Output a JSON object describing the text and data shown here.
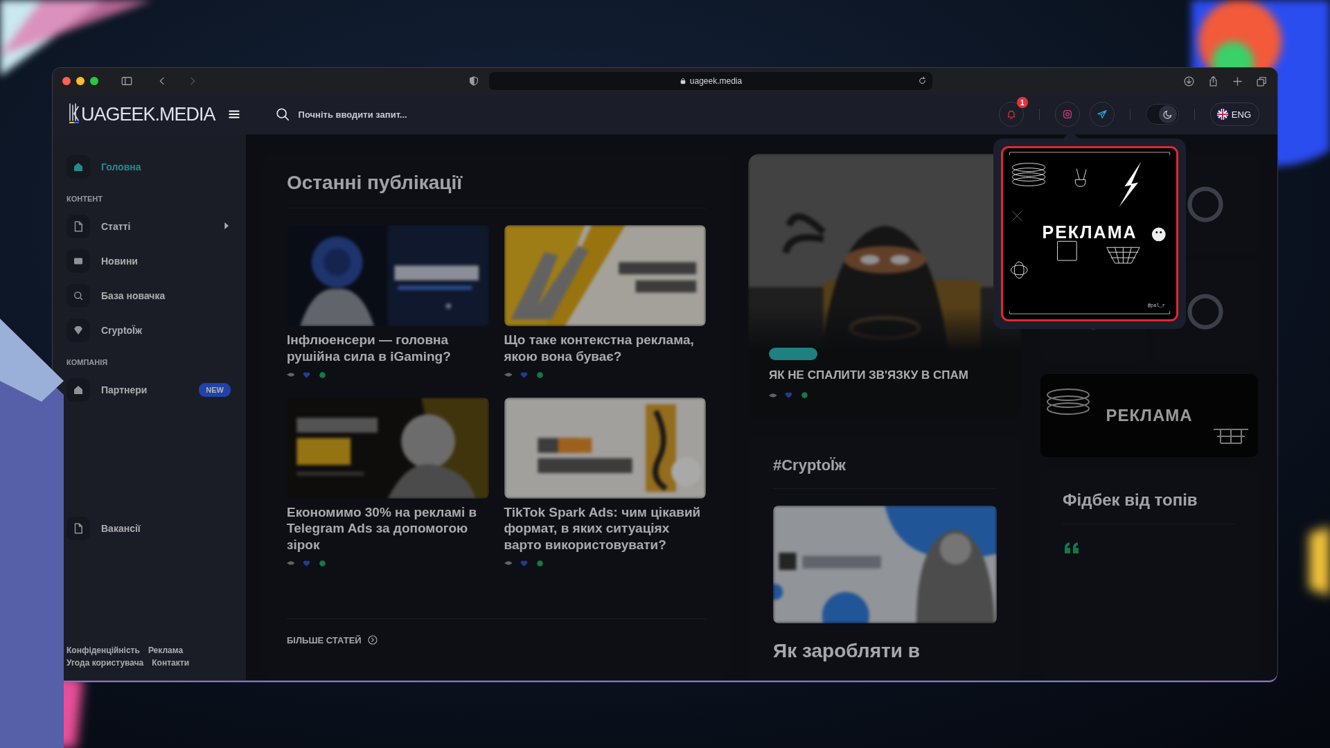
{
  "browser": {
    "url": "uageek.media"
  },
  "header": {
    "logo": "UAGEEK.MEDIA",
    "search": {
      "placeholder": "Почніть вводити запит..."
    },
    "notification_count": "1",
    "dark_mode": true,
    "language": "ENG"
  },
  "sidebar": {
    "items": [
      {
        "kind": "link",
        "label": "Головна",
        "selected": true,
        "has_submenu": false
      },
      {
        "kind": "heading",
        "label": "КОНТЕНТ"
      },
      {
        "kind": "link",
        "label": "Статті",
        "selected": false,
        "has_submenu": true
      },
      {
        "kind": "link",
        "label": "Новини",
        "selected": false,
        "has_submenu": false
      },
      {
        "kind": "link",
        "label": "База новачка",
        "selected": false,
        "has_submenu": false
      },
      {
        "kind": "link",
        "label": "CryptoЇж",
        "selected": false,
        "has_submenu": false
      },
      {
        "kind": "heading",
        "label": "КОМПАНІЯ"
      },
      {
        "kind": "link",
        "label": "Партнери",
        "selected": false,
        "has_submenu": false,
        "badge": "NEW"
      },
      {
        "kind": "gap"
      },
      {
        "kind": "gap"
      },
      {
        "kind": "gap"
      },
      {
        "kind": "link",
        "label": "Вакансії",
        "selected": false,
        "has_submenu": false
      }
    ],
    "footer_links": [
      "Конфіденційність",
      "Реклама",
      "Угода користувача",
      "Контакти"
    ]
  },
  "latest": {
    "title": "Останні публікації",
    "articles": [
      {
        "title": "Інфлюенсери — головна рушійна сила в iGaming?"
      },
      {
        "title": "Що таке контекстна реклама, якою вона буває?"
      },
      {
        "title": "Економимо 30% на рекламі в Telegram Ads за допомогою зірок"
      },
      {
        "title": "TikTok Spark Ads: чим цікавий формат, в яких ситуаціях варто використовувати?"
      }
    ],
    "more_link": "БІЛЬШЕ СТАТЕЙ"
  },
  "featured": {
    "title": "ЯК НЕ СПАЛИТИ ЗВ'ЯЗКУ В СПАМ"
  },
  "crypto": {
    "title": "#CryptoЇж",
    "article_title": "Як заробляти в"
  },
  "side_banner": {
    "text": "РЕКЛАМА"
  },
  "feedback": {
    "title": "Фідбек від топів"
  },
  "popup_ad": {
    "text": "РЕКЛАМА",
    "credit": "@pal_r"
  }
}
